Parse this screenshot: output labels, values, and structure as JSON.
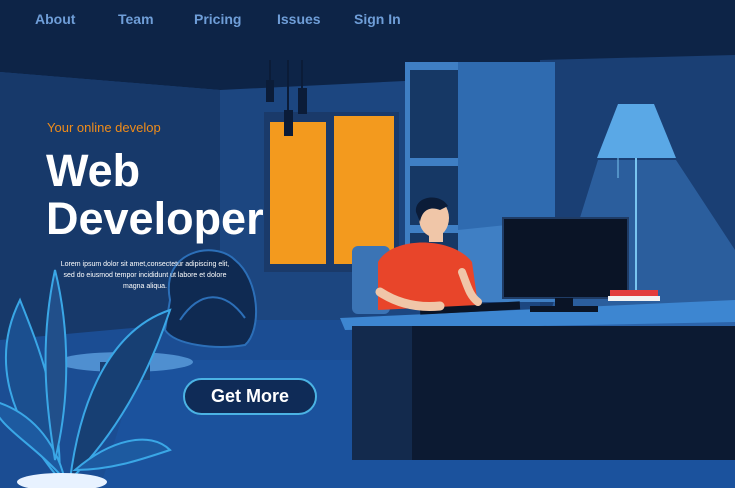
{
  "nav": {
    "items": [
      {
        "label": "About"
      },
      {
        "label": "Team"
      },
      {
        "label": "Pricing"
      },
      {
        "label": "Issues"
      },
      {
        "label": "Sign In"
      }
    ]
  },
  "hero": {
    "tagline": "Your online develop",
    "title_line1": "Web",
    "title_line2": "Developer",
    "description": "Lorem ipsum dolor sit amet,consectetur adipiscing elit, sed do eiusmod tempor incididunt ut labore et dolore magna aliqua.",
    "cta_label": "Get More"
  },
  "colors": {
    "nav_text": "#6f9ed8",
    "accent_orange": "#f08c1a",
    "title_text": "#ffffff",
    "button_border": "#4bb3e4",
    "background_dark": "#0f2748"
  },
  "illustration": {
    "subject": "developer-at-desk-illustration"
  }
}
